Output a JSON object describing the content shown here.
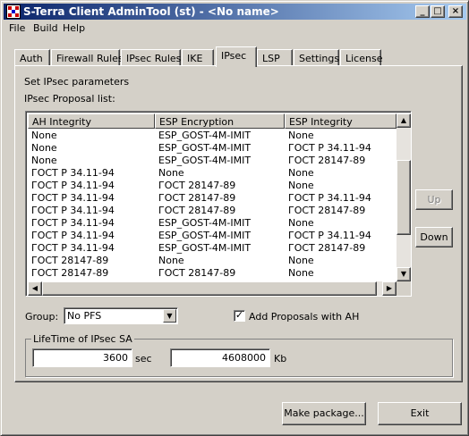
{
  "window": {
    "title": "S-Terra Client AdminTool (st) - <No name>",
    "controls": {
      "minimize": "_",
      "maximize": "□",
      "close": "×"
    }
  },
  "menu": [
    "File",
    "Build",
    "Help"
  ],
  "tabs": [
    {
      "label": "Auth",
      "active": false
    },
    {
      "label": "Firewall Rules",
      "active": false
    },
    {
      "label": "IPsec Rules",
      "active": false
    },
    {
      "label": "IKE",
      "active": false
    },
    {
      "label": "IPsec",
      "active": true
    },
    {
      "label": "LSP",
      "active": false
    },
    {
      "label": "Settings",
      "active": false
    },
    {
      "label": "License",
      "active": false
    }
  ],
  "ipsec": {
    "section_title": "Set IPsec parameters",
    "list_label": "IPsec Proposal list:",
    "columns": [
      "AH Integrity",
      "ESP Encryption",
      "ESP Integrity"
    ],
    "rows": [
      [
        "None",
        "ESP_GOST-4M-IMIT",
        "None"
      ],
      [
        "None",
        "ESP_GOST-4M-IMIT",
        "ГОСТ Р 34.11-94"
      ],
      [
        "None",
        "ESP_GOST-4M-IMIT",
        "ГОСТ 28147-89"
      ],
      [
        "ГОСТ Р 34.11-94",
        "None",
        "None"
      ],
      [
        "ГОСТ Р 34.11-94",
        "ГОСТ 28147-89",
        "None"
      ],
      [
        "ГОСТ Р 34.11-94",
        "ГОСТ 28147-89",
        "ГОСТ Р 34.11-94"
      ],
      [
        "ГОСТ Р 34.11-94",
        "ГОСТ 28147-89",
        "ГОСТ 28147-89"
      ],
      [
        "ГОСТ Р 34.11-94",
        "ESP_GOST-4M-IMIT",
        "None"
      ],
      [
        "ГОСТ Р 34.11-94",
        "ESP_GOST-4M-IMIT",
        "ГОСТ Р 34.11-94"
      ],
      [
        "ГОСТ Р 34.11-94",
        "ESP_GOST-4M-IMIT",
        "ГОСТ 28147-89"
      ],
      [
        "ГОСТ 28147-89",
        "None",
        "None"
      ],
      [
        "ГОСТ 28147-89",
        "ГОСТ 28147-89",
        "None"
      ]
    ],
    "up_label": "Up",
    "down_label": "Down",
    "group_label": "Group:",
    "group_value": "No PFS",
    "add_ah_label": "Add Proposals with AH",
    "add_ah_checked": true,
    "lifetime_title": "LifeTime of IPsec SA",
    "lifetime_seconds": "3600",
    "seconds_unit": "sec",
    "lifetime_kb": "4608000",
    "kb_unit": "Kb"
  },
  "footer": {
    "make_package_label": "Make package...",
    "exit_label": "Exit"
  },
  "colors": {
    "titlebar_start": "#0a246a",
    "titlebar_end": "#a6caf0",
    "face": "#d4d0c8"
  }
}
